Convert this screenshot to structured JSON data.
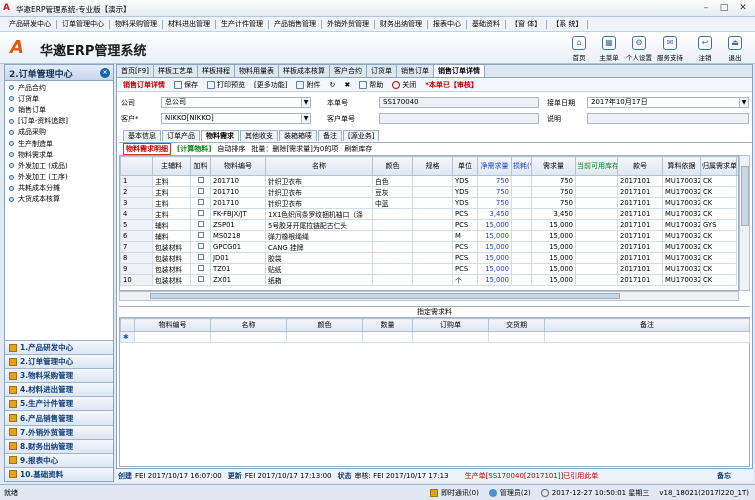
{
  "titlebar": {
    "title": "华邀ERP管理系统-专业版【演示】",
    "logo": "A"
  },
  "menu": [
    "产品研发中心",
    "订单管理中心",
    "物料采购管理",
    "材料进出管理",
    "生产计件管理",
    "产品销售管理",
    "外销外贸管理",
    "财务出纳管理",
    "报表中心",
    "基础资料",
    "【窗 体】",
    "【系 统】"
  ],
  "header": {
    "logo": "A",
    "brand": "华邀ERP管理系统",
    "tools": [
      {
        "icon": "⌂",
        "label": "首页"
      },
      {
        "icon": "▦",
        "label": "主菜单"
      },
      {
        "icon": "⚙",
        "label": "个人设置"
      },
      {
        "icon": "✉",
        "label": "服务支持"
      },
      {
        "icon": "↩",
        "label": "注销"
      },
      {
        "icon": "⏏",
        "label": "退出"
      }
    ]
  },
  "sidebar": {
    "title": "2.订单管理中心",
    "close": "×",
    "items": [
      "产品合约",
      "订货单",
      "销售订单",
      "[订单-资料追踪]",
      "成品采购",
      "生产制造单",
      "物料需求单",
      "外发加工 (成品)",
      "外发加工 (工序)",
      "共耗成本分摊",
      "大货成本核算"
    ]
  },
  "modules": [
    "1.产品研发中心",
    "2.订单管理中心",
    "3.物料采购管理",
    "4.材料进出管理",
    "5.生产计件管理",
    "6.产品销售管理",
    "7.外销外贸管理",
    "8.财务出纳管理",
    "9.报表中心",
    "10.基础资料"
  ],
  "tabs": [
    "首页[F9]",
    "样板工艺单",
    "样板排程",
    "物料用量表",
    "样板成本核算",
    "客户合约",
    "订货单",
    "销售订单",
    "销售订单详情"
  ],
  "toolbar": [
    "销售订单详情",
    "保存",
    "打印预览",
    "[更多功能]",
    "附件",
    "↻",
    "✖",
    "帮助",
    "关闭",
    "*本单已【审核】"
  ],
  "form": {
    "company_label": "公司",
    "company": "总公司",
    "order_no_label": "本单号",
    "order_no": "SS170040",
    "date_label": "接单日期",
    "date": "2017年10月17日",
    "customer_label": "客户*",
    "customer": "NIKKO[NIKKO]",
    "cust_order_label": "客户单号",
    "cust_order": "",
    "note_label": "说明",
    "note": ""
  },
  "subtabs": [
    "基本信息",
    "订单产品",
    "物料需求",
    "其他收支",
    "装箱箱唛",
    "备注",
    "[源业务]"
  ],
  "subtool": [
    "物料需求明细",
    "[计算物料]",
    "自动排序",
    "批量：删除[需求量]为0的项",
    "刷新库存"
  ],
  "grid": {
    "headers": [
      "主辅料",
      "加料",
      "物料编号",
      "名称",
      "颜色",
      "规格",
      "单位",
      "净需求量",
      "损耗(%)",
      "需求量",
      "当前可用库存",
      "款号",
      "算料依据",
      "归属需求单",
      ""
    ],
    "rows": [
      [
        "1",
        "主料",
        "",
        "201710",
        "针织卫衣布",
        "白色",
        "",
        "YDS",
        "750",
        "",
        "750",
        "",
        "2017101",
        "MU170032",
        "CK"
      ],
      [
        "2",
        "主料",
        "",
        "201710",
        "针织卫衣布",
        "豆灰",
        "",
        "YDS",
        "750",
        "",
        "750",
        "",
        "2017101",
        "MU170032",
        "CK"
      ],
      [
        "3",
        "主料",
        "",
        "201710",
        "针织卫衣布",
        "中蓝",
        "",
        "YDS",
        "750",
        "",
        "750",
        "",
        "2017101",
        "MU170032",
        "CK"
      ],
      [
        "4",
        "主料",
        "",
        "FK-FBJX/JT",
        "1X1色织间条罗纹捆机袖口（涤",
        "",
        "",
        "PCS",
        "3,450",
        "",
        "3,450",
        "",
        "2017101",
        "MU170032",
        "CK"
      ],
      [
        "5",
        "辅料",
        "",
        "ZSP01",
        "5号胶牙开尾拉链配古仁头",
        "",
        "",
        "PCS",
        "15,000",
        "",
        "15,000",
        "",
        "2017101",
        "MU170032",
        "GYS"
      ],
      [
        "6",
        "辅料",
        "",
        "MS0218",
        "弹力橡根绳绳",
        "",
        "",
        "M",
        "15,000",
        "",
        "15,000",
        "",
        "2017101",
        "MU170032",
        "CK"
      ],
      [
        "7",
        "包装材料",
        "",
        "GPCG01",
        "CANG 挂牌",
        "",
        "",
        "PCS",
        "15,000",
        "",
        "15,000",
        "",
        "2017101",
        "MU170032",
        "CK"
      ],
      [
        "8",
        "包装材料",
        "",
        "JD01",
        "胶袋",
        "",
        "",
        "PCS",
        "15,000",
        "",
        "15,000",
        "",
        "2017101",
        "MU170032",
        "CK"
      ],
      [
        "9",
        "包装材料",
        "",
        "TZ01",
        "贴纸",
        "",
        "",
        "PCS",
        "15,000",
        "",
        "15,000",
        "",
        "2017101",
        "MU170032",
        "CK"
      ],
      [
        "10",
        "包装材料",
        "",
        "ZX01",
        "纸箱",
        "",
        "",
        "个",
        "15,000",
        "",
        "15,000",
        "",
        "2017101",
        "MU170032",
        "CK"
      ]
    ]
  },
  "sec2": {
    "title": "指定需求料",
    "headers": [
      "物料编号",
      "名称",
      "颜色",
      "数量",
      "订购单",
      "交货期",
      "备注"
    ],
    "marker": "✱"
  },
  "status": {
    "created_label": "创建",
    "created": "FEI 2017/10/17 16:07:00",
    "updated_label": "更新",
    "updated": "FEI 2017/10/17 17:13:00",
    "state_label": "状态",
    "state": "审核: FEI 2017/10/17 17:13",
    "flow": "生产单[SS170040[2017101]]已引用此单",
    "memo_label": "备忘"
  },
  "bottom": {
    "ready": "就绪",
    "im": "即时通讯(0)",
    "user": "管理员(2)",
    "datetime": "2017-12-27 10:50:01 星期三",
    "version": "v18_18021(2017l220_1T)"
  },
  "colors": {
    "accent": "#c00000",
    "brand": "#e05a10",
    "header_blue": "#1940c8",
    "green": "#0a7d1a"
  }
}
